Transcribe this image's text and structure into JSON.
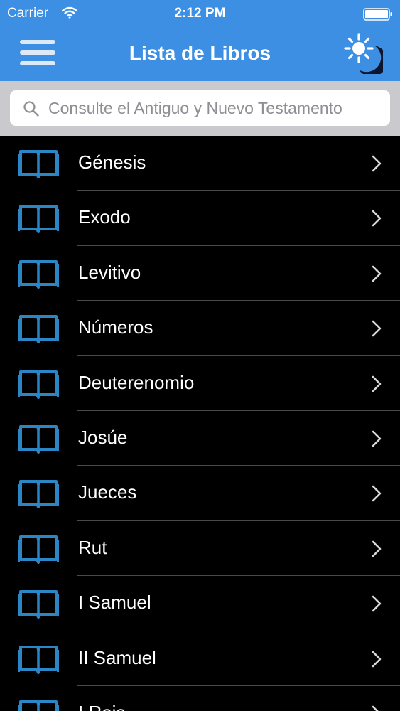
{
  "status_bar": {
    "carrier": "Carrier",
    "time": "2:12 PM"
  },
  "nav": {
    "title": "Lista de Libros",
    "menu_icon": "hamburger-menu-icon",
    "mode_icon": "sun-moon-icon"
  },
  "search": {
    "placeholder": "Consulte el Antiguo y Nuevo Testamento",
    "value": ""
  },
  "books": [
    {
      "name": "Génesis"
    },
    {
      "name": "Exodo"
    },
    {
      "name": "Levitivo"
    },
    {
      "name": "Números"
    },
    {
      "name": "Deuterenomio"
    },
    {
      "name": "Josúe"
    },
    {
      "name": "Jueces"
    },
    {
      "name": "Rut"
    },
    {
      "name": "I Samuel"
    },
    {
      "name": "II Samuel"
    },
    {
      "name": "I Reis"
    }
  ],
  "colors": {
    "header_blue": "#3d8fe3",
    "book_icon_blue": "#2b86c5",
    "list_background": "#000000",
    "separator": "#4a4a4a"
  }
}
